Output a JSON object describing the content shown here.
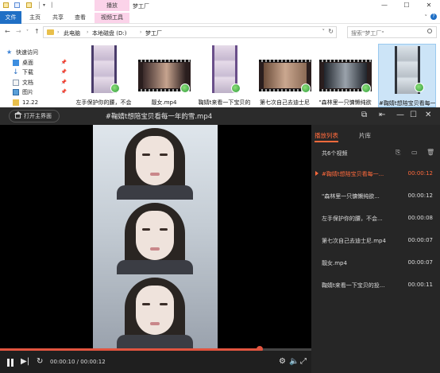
{
  "explorer": {
    "title": "梦工厂",
    "ribbon": {
      "context_tab": "播放",
      "tabs": [
        "文件",
        "主页",
        "共享",
        "查看",
        "视频工具"
      ]
    },
    "address": {
      "crumbs": [
        "此电脑",
        "本地磁盘 (D:)",
        "梦工厂"
      ],
      "search_placeholder": "搜索\"梦工厂\""
    },
    "nav": {
      "items": [
        "快速访问",
        "桌面",
        "下载",
        "文档",
        "图片",
        "12.22"
      ]
    },
    "files": [
      {
        "name": "左手保护你的腰，不会",
        "thumb": "portrait"
      },
      {
        "name": "靓女.mp4",
        "thumb": "landscape"
      },
      {
        "name": "鞠婧t来看一下宝贝的",
        "thumb": "portrait"
      },
      {
        "name": "第七次自己去迪士尼",
        "thumb": "landscape"
      },
      {
        "name": "\"森林里一只慵懒纯欲",
        "thumb": "landscape"
      },
      {
        "name": "#鞠婧t想陪宝贝看每一",
        "thumb": "portrait",
        "selected": true
      }
    ]
  },
  "player": {
    "home_button": "打开主界面",
    "title": "#鞠婧t想陪宝贝看每一年的雪.mp4",
    "time": "00:00:10 / 00:00:12",
    "progress": 0.833,
    "tabs": [
      "播放列表",
      "片库"
    ],
    "count": "共6个视频",
    "playlist": [
      {
        "name": "#鞠婧t想陪宝贝看每一...",
        "duration": "00:00:12",
        "active": true
      },
      {
        "name": "\"森林里一只慵懒纯欲...",
        "duration": "00:00:12"
      },
      {
        "name": "左手保护你的腰，不会...",
        "duration": "00:00:08"
      },
      {
        "name": "第七次自己去迪士尼.mp4",
        "duration": "00:00:07"
      },
      {
        "name": "靓女.mp4",
        "duration": "00:00:07"
      },
      {
        "name": "鞠婧t来看一下宝贝的投...",
        "duration": "00:00:11"
      }
    ]
  },
  "colors": {
    "accent": "#ff6a3c",
    "progress": "#e2543f",
    "ribbon_file": "#1f6fc5",
    "context_tab": "#fbd3e9"
  }
}
